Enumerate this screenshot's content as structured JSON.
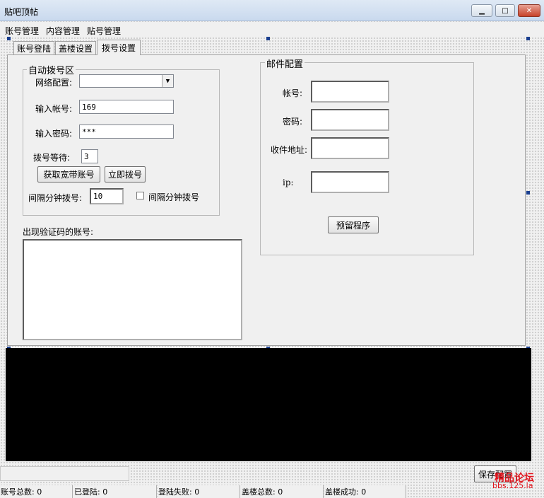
{
  "window": {
    "title": "贴吧顶帖",
    "minimize": "▁",
    "maximize": "□",
    "close": "✕"
  },
  "menu": [
    "账号管理",
    "内容管理",
    "贴号管理"
  ],
  "tabs": [
    "账号登陆",
    "盖楼设置",
    "拨号设置"
  ],
  "auto_dial": {
    "legend": "自动拨号区",
    "network_label": "网络配置:",
    "network_value": "",
    "account_label": "输入帐号:",
    "account_value": "169",
    "password_label": "输入密码:",
    "password_value": "***",
    "wait_label": "拨号等待:",
    "wait_value": "3",
    "get_account_button": "获取宽带账号",
    "dial_now_button": "立即拨号",
    "interval_label": "间隔分钟拨号:",
    "interval_value": "10",
    "interval_checkbox_label": "间隔分钟拨号",
    "interval_checked": false
  },
  "captcha": {
    "label": "出现验证码的账号:",
    "content": ""
  },
  "mail": {
    "legend": "邮件配置",
    "account_label": "帐号:",
    "password_label": "密码:",
    "recipient_label": "收件地址:",
    "ip_label": "ip:",
    "account_value": "",
    "password_value": "",
    "recipient_value": "",
    "ip_value": "",
    "reserve_button": "预留程序"
  },
  "save_button": "保存配置",
  "status": [
    "账号总数: 0",
    "已登陆: 0",
    "登陆失败: 0",
    "盖楼总数: 0",
    "盖楼成功: 0"
  ],
  "watermark": {
    "line1": "精品论坛",
    "line2": "bbs.125.la",
    "color": "#e2141d"
  },
  "colors": {
    "log_background": "#000000",
    "selection_handle": "#1a3f8f"
  }
}
